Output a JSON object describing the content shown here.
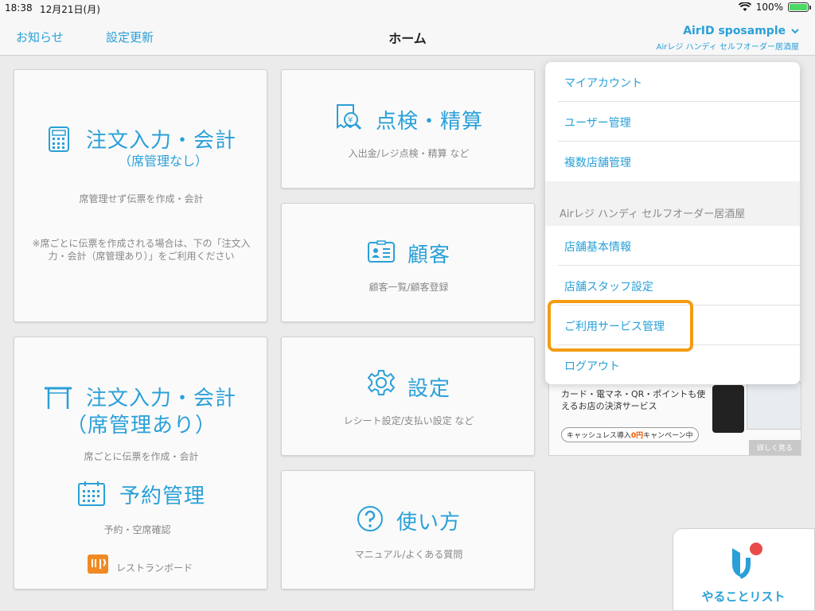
{
  "status": {
    "time": "18:38",
    "date": "12月21日(月)",
    "battery": "100%"
  },
  "nav": {
    "notice": "お知らせ",
    "refresh": "設定更新",
    "title": "ホーム",
    "airid": "AirID sposample",
    "store": "Airレジ ハンディ セルフオーダー居酒屋"
  },
  "tiles": {
    "order_noseat": {
      "title": "注文入力・会計",
      "paren": "（席管理なし）",
      "desc": "席管理せず伝票を作成・会計",
      "note": "※席ごとに伝票を作成される場合は、下の「注文入力・会計（席管理あり）」をご利用ください"
    },
    "check": {
      "title": "点検・精算",
      "desc": "入出金/レジ点検・精算 など"
    },
    "customer": {
      "title": "顧客",
      "desc": "顧客一覧/顧客登録"
    },
    "order_seat": {
      "title": "注文入力・会計",
      "paren": "（席管理あり）",
      "desc": "席ごとに伝票を作成・会計"
    },
    "reserve": {
      "title": "予約管理",
      "desc": "予約・空席確認",
      "board": "レストランボード"
    },
    "settings": {
      "title": "設定",
      "desc": "レシート設定/支払い設定 など"
    },
    "howto": {
      "title": "使い方",
      "desc": "マニュアル/よくある質問"
    }
  },
  "menu": {
    "account": [
      "マイアカウント",
      "ユーザー管理",
      "複数店舗管理"
    ],
    "section": "Airレジ ハンディ セルフオーダー居酒屋",
    "store": [
      "店舗基本情報",
      "店舗スタッフ設定",
      "ご利用サービス管理",
      "ログアウト"
    ]
  },
  "promo": {
    "text": "カード・電マネ・QR・ポイントも使えるお店の決済サービス",
    "badge_pre": "キャッシュレス導入",
    "badge_hl": "0円",
    "badge_post": "キャンペーン中",
    "more": "詳しく見る"
  },
  "todo": {
    "label": "やることリスト"
  },
  "colors": {
    "accent": "#2aa0d8",
    "highlight": "#f39c12",
    "todo_dot": "#e94b4b"
  }
}
